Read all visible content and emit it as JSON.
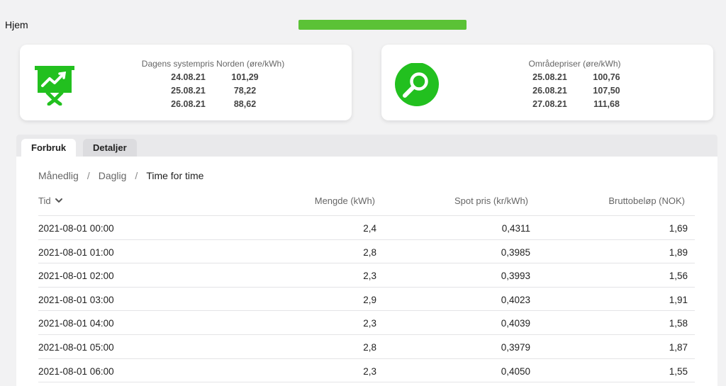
{
  "nav": {
    "home_label": "Hjem"
  },
  "cards": {
    "system": {
      "title": "Dagens systempris Norden (øre/kWh)",
      "icon": "chart-presentation-icon",
      "rows": [
        {
          "date": "24.08.21",
          "value": "101,29"
        },
        {
          "date": "25.08.21",
          "value": "78,22"
        },
        {
          "date": "26.08.21",
          "value": "88,62"
        }
      ]
    },
    "area": {
      "title": "Områdepriser (øre/kWh)",
      "icon": "search-icon",
      "rows": [
        {
          "date": "25.08.21",
          "value": "100,76"
        },
        {
          "date": "26.08.21",
          "value": "107,50"
        },
        {
          "date": "27.08.21",
          "value": "111,68"
        }
      ]
    }
  },
  "tabs": {
    "forbruk": "Forbruk",
    "detaljer": "Detaljer"
  },
  "breadcrumb": {
    "monthly": "Månedlig",
    "daily": "Daglig",
    "hourly": "Time for time",
    "sep": "/"
  },
  "table": {
    "headers": {
      "time": "Tid",
      "amount": "Mengde (kWh)",
      "spot": "Spot pris (kr/kWh)",
      "gross": "Bruttobeløp (NOK)"
    },
    "rows": [
      {
        "time": "2021-08-01 00:00",
        "amount": "2,4",
        "spot": "0,4311",
        "gross": "1,69"
      },
      {
        "time": "2021-08-01 01:00",
        "amount": "2,8",
        "spot": "0,3985",
        "gross": "1,89"
      },
      {
        "time": "2021-08-01 02:00",
        "amount": "2,3",
        "spot": "0,3993",
        "gross": "1,56"
      },
      {
        "time": "2021-08-01 03:00",
        "amount": "2,9",
        "spot": "0,4023",
        "gross": "1,91"
      },
      {
        "time": "2021-08-01 04:00",
        "amount": "2,3",
        "spot": "0,4039",
        "gross": "1,58"
      },
      {
        "time": "2021-08-01 05:00",
        "amount": "2,8",
        "spot": "0,3979",
        "gross": "1,87"
      },
      {
        "time": "2021-08-01 06:00",
        "amount": "2,3",
        "spot": "0,4050",
        "gross": "1,55"
      }
    ]
  },
  "colors": {
    "accent": "#22c01f",
    "redaction": "#5bc236"
  }
}
